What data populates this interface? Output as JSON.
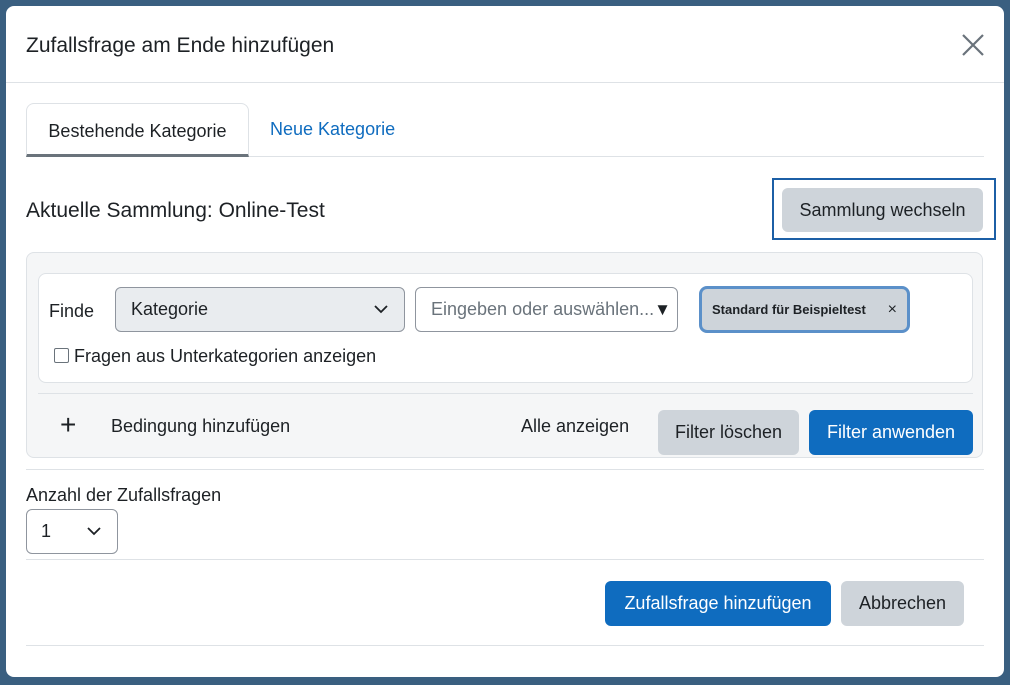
{
  "modal": {
    "title": "Zufallsfrage am Ende hinzufügen",
    "close_icon": "close-icon"
  },
  "tabs": [
    {
      "label": "Bestehende Kategorie",
      "active": true
    },
    {
      "label": "Neue Kategorie",
      "active": false
    }
  ],
  "collection": {
    "title": "Aktuelle Sammlung: Online-Test",
    "switch_label": "Sammlung wechseln"
  },
  "filter": {
    "find_label": "Finde",
    "type_select": "Kategorie",
    "autocomplete_placeholder": "Eingeben oder auswählen...",
    "selected_tag": "Standard für Beispieltest",
    "tag_remove": "×",
    "subcategories_label": "Fragen aus Unterkategorien anzeigen",
    "subcategories_checked": false,
    "add_condition_icon": "+",
    "add_condition_label": "Bedingung hinzufügen",
    "show_all_label": "Alle anzeigen",
    "clear_label": "Filter löschen",
    "apply_label": "Filter anwenden"
  },
  "random_count": {
    "label": "Anzahl der Zufallsfragen",
    "value": "1"
  },
  "footer": {
    "add_label": "Zufallsfrage hinzufügen",
    "cancel_label": "Abbrechen"
  },
  "colors": {
    "primary": "#0f6cbf",
    "secondary": "#ced4da",
    "focus": "#1c5fa6"
  }
}
